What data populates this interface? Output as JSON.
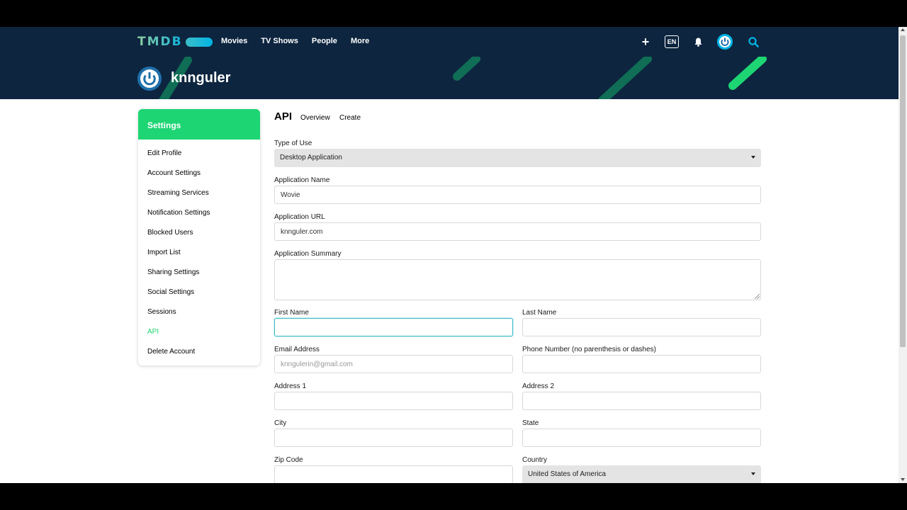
{
  "header": {
    "logo_text": "TMDB",
    "nav": [
      "Movies",
      "TV Shows",
      "People",
      "More"
    ],
    "lang": "EN",
    "icons": [
      "plus-icon",
      "bell-icon",
      "avatar-icon",
      "search-icon"
    ]
  },
  "profile": {
    "username": "knnguler"
  },
  "sidebar": {
    "title": "Settings",
    "items": [
      {
        "label": "Edit Profile"
      },
      {
        "label": "Account Settings"
      },
      {
        "label": "Streaming Services"
      },
      {
        "label": "Notification Settings"
      },
      {
        "label": "Blocked Users"
      },
      {
        "label": "Import List"
      },
      {
        "label": "Sharing Settings"
      },
      {
        "label": "Social Settings"
      },
      {
        "label": "Sessions"
      },
      {
        "label": "API",
        "active": true
      },
      {
        "label": "Delete Account"
      }
    ]
  },
  "main": {
    "title": "API",
    "tabs": [
      "Overview",
      "Create"
    ],
    "form": {
      "type_of_use": {
        "label": "Type of Use",
        "value": "Desktop Application"
      },
      "app_name": {
        "label": "Application Name",
        "value": "Wovie"
      },
      "app_url": {
        "label": "Application URL",
        "value": "knnguler.com"
      },
      "app_summary": {
        "label": "Application Summary",
        "value": ""
      },
      "first_name": {
        "label": "First Name",
        "value": ""
      },
      "last_name": {
        "label": "Last Name",
        "value": ""
      },
      "email": {
        "label": "Email Address",
        "placeholder": "knngulerin@gmail.com"
      },
      "phone": {
        "label": "Phone Number (no parenthesis or dashes)",
        "value": ""
      },
      "address1": {
        "label": "Address 1",
        "value": ""
      },
      "address2": {
        "label": "Address 2",
        "value": ""
      },
      "city": {
        "label": "City",
        "value": ""
      },
      "state": {
        "label": "State",
        "value": ""
      },
      "zip": {
        "label": "Zip Code",
        "value": ""
      },
      "country": {
        "label": "Country",
        "value": "United States of America"
      }
    }
  },
  "colors": {
    "navy": "#0d253f",
    "green": "#1ed574",
    "teal": "#01b4e4",
    "stripe": "#0f6e55"
  }
}
